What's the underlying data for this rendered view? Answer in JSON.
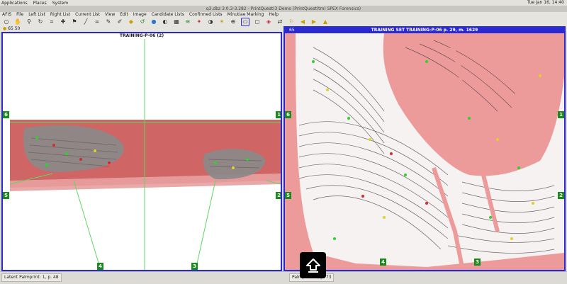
{
  "panel": {
    "menus": [
      "Applications",
      "Places",
      "System"
    ],
    "clock": "Tue Jan 16, 14:40"
  },
  "window": {
    "title": "q3.dbz 3.0.3-3.282 - PrintQuest(3 Demo (PrintQuest(tm) SPEX Forensics)"
  },
  "menubar": {
    "items": [
      "AFIS",
      "File",
      "Left List",
      "Right List",
      "Current List",
      "View",
      "Edit",
      "Image",
      "Candidate Lists",
      "Confirmed Lists",
      "Minutiae Marking",
      "Help"
    ]
  },
  "toolbar": {
    "icons": [
      "circle-icon",
      "hand-icon",
      "zoom-icon",
      "rotate-icon",
      "crop-icon",
      "mark-icon",
      "flag-icon",
      "line-icon",
      "link-icon",
      "paint-icon",
      "pen-icon",
      "mask-icon",
      "undo-icon",
      "circle-icon",
      "color-icon",
      "grid-icon",
      "ridge-icon",
      "brush-icon",
      "contrast-icon",
      "minutia-icon",
      "crosshair-icon",
      "fit-icon",
      "zoom-fit-icon",
      "compare-icon",
      "swap-icon",
      "pin-icon",
      "arrow-left-icon",
      "arrow-right-icon",
      "arrow-up-icon"
    ]
  },
  "info": {
    "row": "65 50"
  },
  "left_panel": {
    "title": "TRAINING-P-06 (2)",
    "markers": [
      "6",
      "1",
      "5",
      "2",
      "4",
      "3"
    ]
  },
  "right_panel": {
    "title": "TRAINING SET  TRAINING-P-06    p. 29, m. 1629",
    "badge": "65",
    "markers": [
      "6",
      "1",
      "5",
      "2",
      "4",
      "3"
    ]
  },
  "status": {
    "left": "Latent Palmprint: 1, p. 48",
    "right": "Palmprint: 1, p. 73"
  }
}
